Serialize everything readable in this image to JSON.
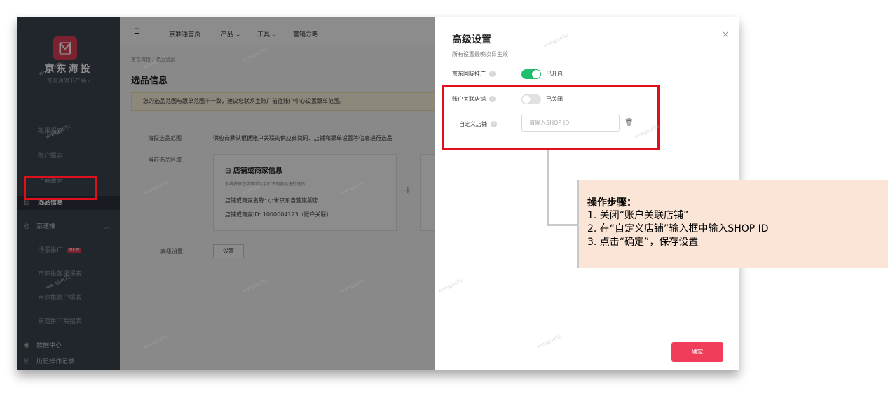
{
  "sidebar": {
    "brand_name": "京东海投",
    "brand_sub": "京准通旗下产品 ›",
    "items": [
      {
        "label": "效果报表"
      },
      {
        "label": "账户报表"
      },
      {
        "label": "下载报表"
      },
      {
        "label": "选品信息"
      },
      {
        "label": "京速推"
      },
      {
        "label": "场景推广",
        "badge": "NEW"
      },
      {
        "label": "京速推效果报表"
      },
      {
        "label": "京速推账户报表"
      },
      {
        "label": "京速推下载报表"
      },
      {
        "label": "数据中心"
      },
      {
        "label": "历史操作记录"
      }
    ]
  },
  "topnav": {
    "menu_icon": "☰",
    "items": [
      "京准通首页",
      "产品 ⌄",
      "工具 ⌄",
      "营销方略"
    ]
  },
  "main": {
    "breadcrumb": "京东海投 / 选品信息",
    "page_title": "选品信息",
    "notice": "您的选品范围与跟单范围不一致，建议您联系主账户前往账户中心设置跟单范围。",
    "scope_label": "海投选品范围",
    "scope_text": "供应商默认根据账户关联的供应商简码、店铺和跟单设置等信息进行选品",
    "region_label": "当前选品区域",
    "card": {
      "title": "店铺或商家信息",
      "subtitle": "系统将按您店铺或商家ID下的商品进行选品",
      "name_line": "店铺或商家名称: 小米京东自营旗舰店",
      "id_line": "店铺或商家ID: 1000004123（账户关联）"
    },
    "advanced_label": "高级设置",
    "set_button": "设置"
  },
  "drawer": {
    "title": "高级设置",
    "subtitle": "所有设置最晚次日生效",
    "close": "×",
    "row1": {
      "label": "京东国际推广",
      "state": "已开启"
    },
    "row2": {
      "label": "账户关联店铺",
      "state": "已关闭"
    },
    "row3": {
      "label": "自定义店铺",
      "placeholder": "请输入SHOP ID"
    },
    "confirm": "确定"
  },
  "callout": {
    "title": "操作步骤：",
    "steps": [
      "1.  关闭“账户关联店铺”",
      "2.  在“自定义店铺”输入框中输入SHOP ID",
      "3.  点击“确定”，保存设置"
    ]
  },
  "colors": {
    "sidebar_bg": "#3d4451",
    "accent_red": "#e23d56",
    "switch_on": "#1fbf6b",
    "callout_bg": "#fbe5d6",
    "highlight_border": "#e0101b"
  },
  "watermark": "wangjue32"
}
